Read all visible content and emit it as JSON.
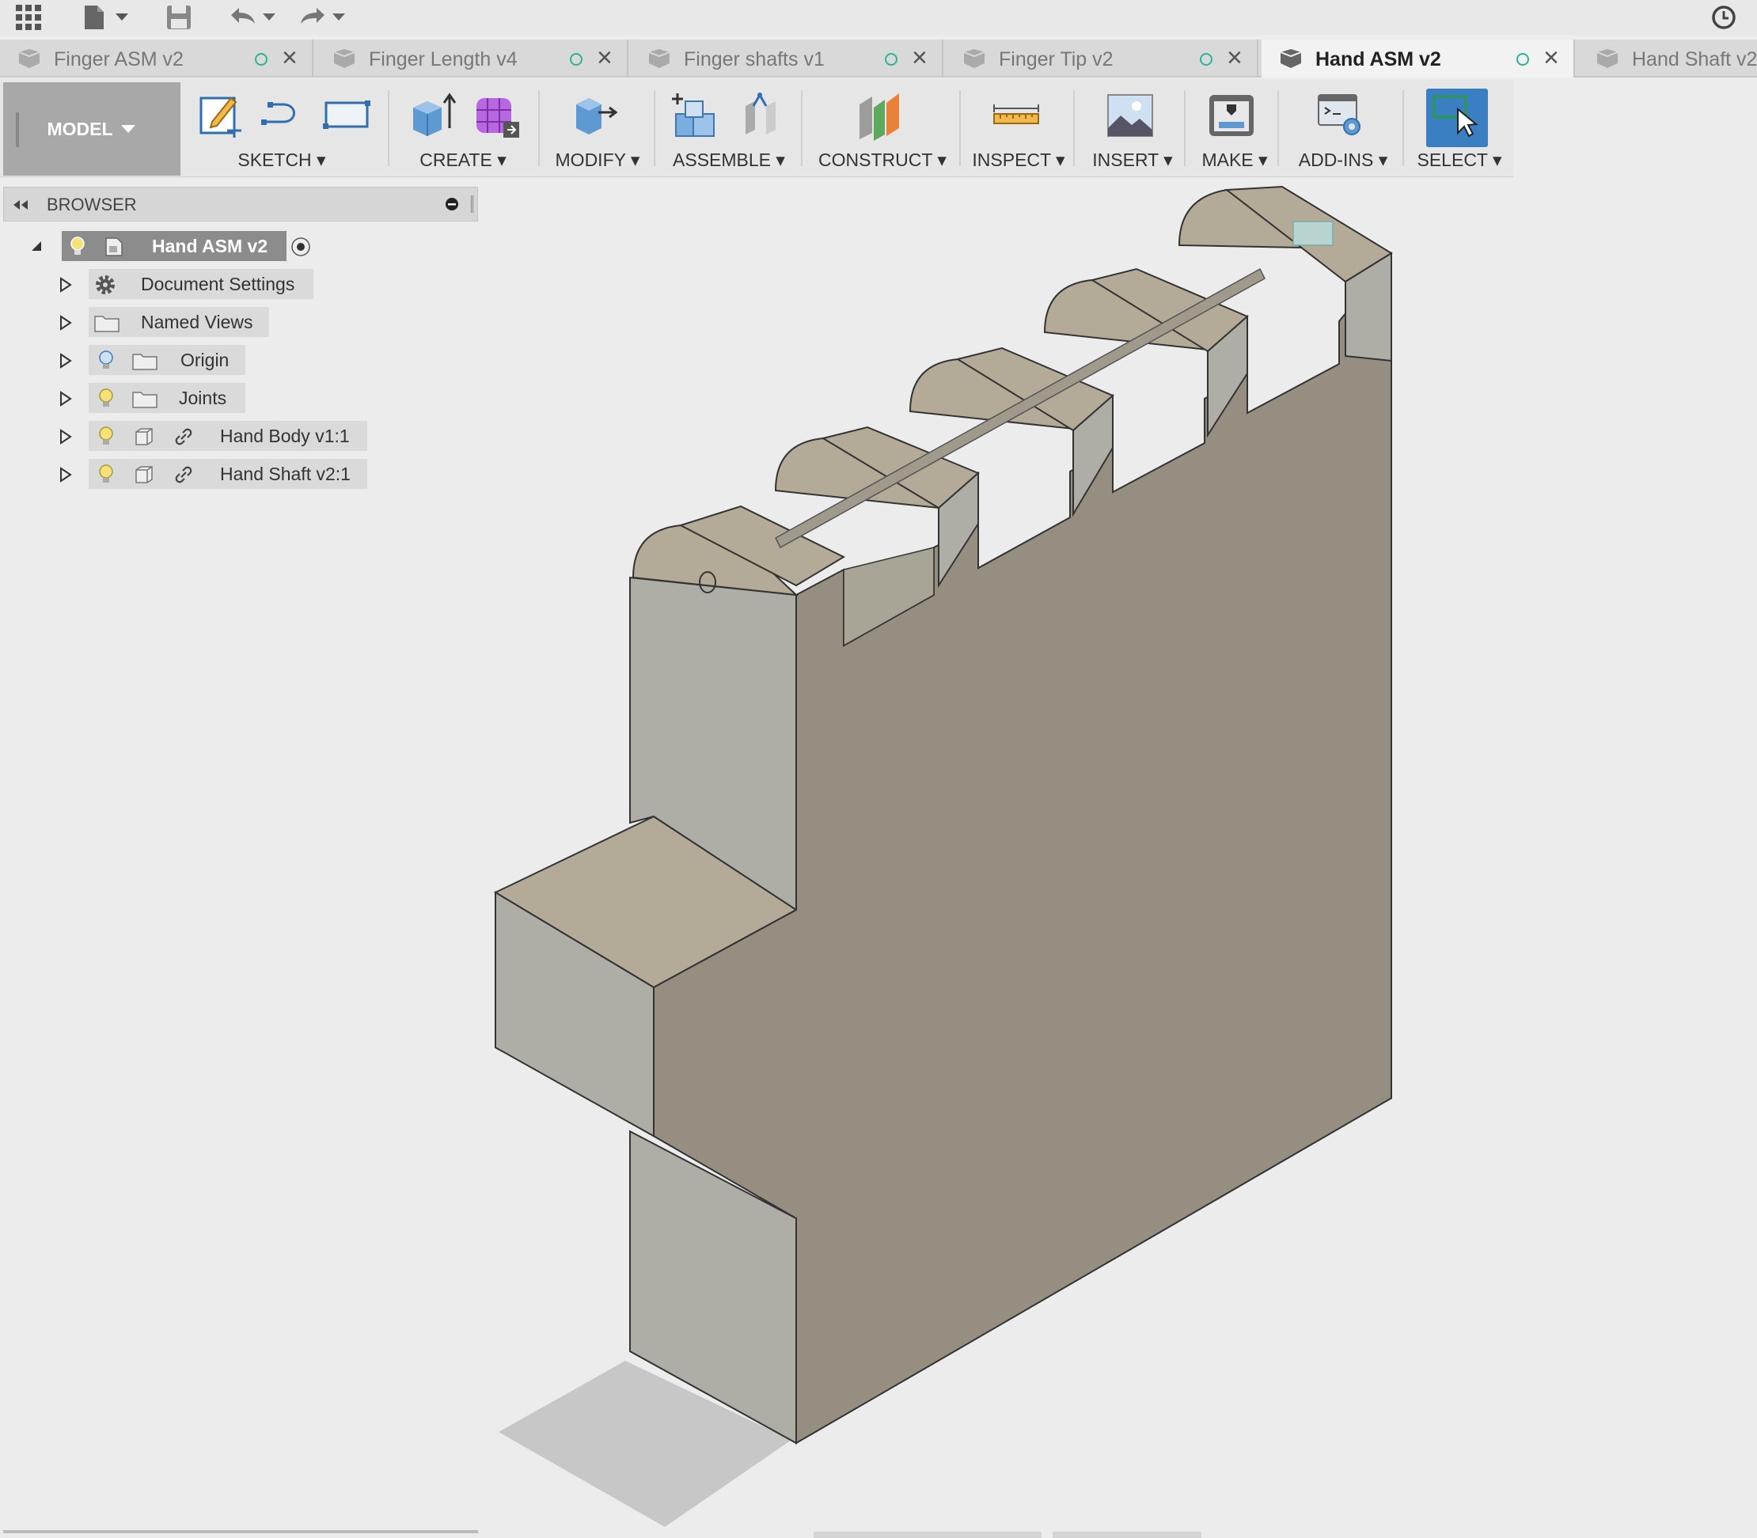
{
  "toolbar": {
    "icons": [
      "app-grid-icon",
      "file-icon",
      "save-icon",
      "undo-icon",
      "redo-icon",
      "job-status-clock-icon"
    ]
  },
  "tabs": [
    {
      "label": "Finger ASM v2",
      "active": false
    },
    {
      "label": "Finger Length v4",
      "active": false
    },
    {
      "label": "Finger shafts v1",
      "active": false
    },
    {
      "label": "Finger Tip v2",
      "active": false
    },
    {
      "label": "Hand ASM v2",
      "active": true
    },
    {
      "label": "Hand Shaft v2",
      "active": false
    }
  ],
  "ribbon": {
    "workspace": "MODEL",
    "groups": {
      "sketch": "SKETCH",
      "create": "CREATE",
      "modify": "MODIFY",
      "assemble": "ASSEMBLE",
      "construct": "CONSTRUCT",
      "inspect": "INSPECT",
      "insert": "INSERT",
      "make": "MAKE",
      "addins": "ADD-INS",
      "select": "SELECT"
    }
  },
  "browser": {
    "title": "BROWSER",
    "root": "Hand ASM v2",
    "items": [
      {
        "label": "Document Settings",
        "icon": "gear-icon"
      },
      {
        "label": "Named Views",
        "icon": "folder-icon"
      },
      {
        "label": "Origin",
        "icon": "folder-icon"
      },
      {
        "label": "Joints",
        "icon": "folder-icon"
      },
      {
        "label": "Hand Body v1:1",
        "icon": "component-icon"
      },
      {
        "label": "Hand Shaft v2:1",
        "icon": "component-icon"
      }
    ]
  },
  "colors": {
    "accent": "#3a7fc1",
    "model_face": "#968e80",
    "model_top": "#b3ab98",
    "model_side": "#aeaea7",
    "status_dot": "#2bb39a"
  }
}
